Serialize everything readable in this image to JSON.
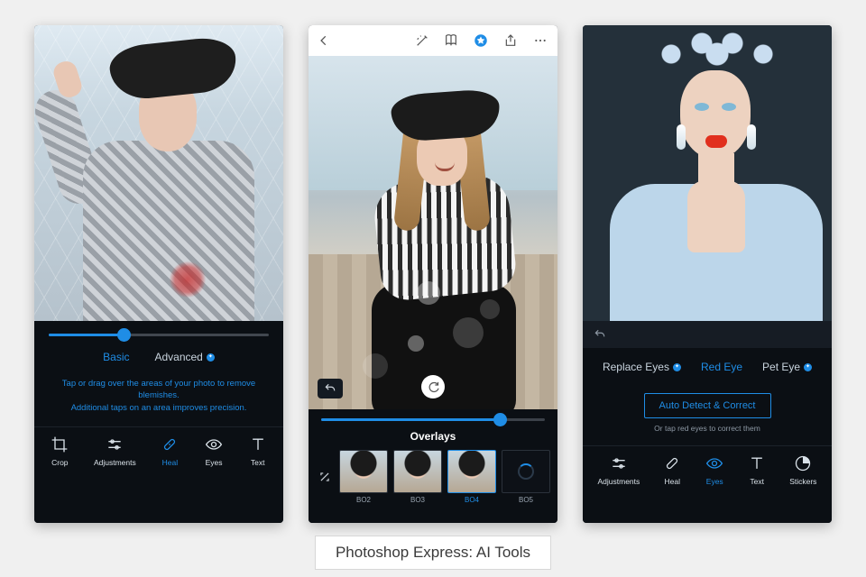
{
  "caption": "Photoshop Express: AI Tools",
  "phone1": {
    "slider_percent": 34,
    "tabs": {
      "basic": "Basic",
      "advanced": "Advanced"
    },
    "active_tab": "basic",
    "hint_line1": "Tap or drag over the areas of your photo to remove blemishes.",
    "hint_line2": "Additional taps on an area improves precision.",
    "tools": [
      {
        "id": "crop",
        "label": "Crop"
      },
      {
        "id": "adjustments",
        "label": "Adjustments"
      },
      {
        "id": "heal",
        "label": "Heal"
      },
      {
        "id": "eyes",
        "label": "Eyes"
      },
      {
        "id": "text",
        "label": "Text"
      }
    ],
    "active_tool": "heal"
  },
  "phone2": {
    "slider_percent": 80,
    "section_title": "Overlays",
    "thumbs": [
      {
        "id": "BO2",
        "label": "BO2"
      },
      {
        "id": "BO3",
        "label": "BO3"
      },
      {
        "id": "BO4",
        "label": "BO4"
      },
      {
        "id": "BO5",
        "label": "BO5"
      }
    ],
    "active_thumb": "BO4",
    "loading_thumb": "BO5"
  },
  "phone3": {
    "tabs": [
      {
        "id": "replace-eyes",
        "label": "Replace Eyes",
        "ai": true
      },
      {
        "id": "red-eye",
        "label": "Red Eye",
        "ai": false
      },
      {
        "id": "pet-eye",
        "label": "Pet Eye",
        "ai": true
      }
    ],
    "active_tab": "red-eye",
    "auto_button": "Auto Detect & Correct",
    "auto_sub": "Or tap red eyes to correct them",
    "tools": [
      {
        "id": "adjustments",
        "label": "Adjustments"
      },
      {
        "id": "heal",
        "label": "Heal"
      },
      {
        "id": "eyes",
        "label": "Eyes"
      },
      {
        "id": "text",
        "label": "Text"
      },
      {
        "id": "stickers",
        "label": "Stickers"
      }
    ],
    "active_tool": "eyes"
  }
}
